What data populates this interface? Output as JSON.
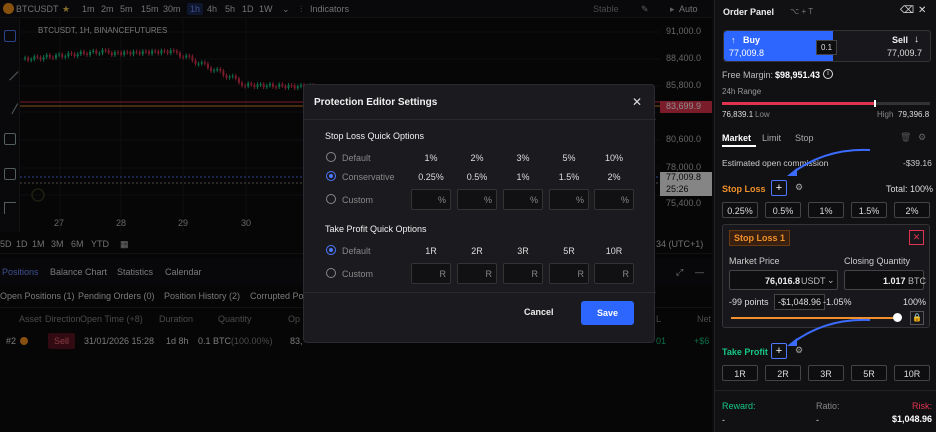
{
  "toolbar": {
    "symbol": "BTCUSDT",
    "intervals": [
      "1m",
      "2m",
      "5m",
      "15m",
      "30m",
      "1h",
      "4h",
      "5h",
      "1D",
      "1W"
    ],
    "indicators": "Indicators",
    "stable": "Stable",
    "auto": "Auto"
  },
  "chart": {
    "legend": "BTCUSDT, 1H, BINANCEFUTURES",
    "prices": [
      "91,000.0",
      "88,400.0",
      "85,800.0",
      "80,600.0",
      "78,000.0",
      "75,400.0"
    ],
    "tag_red": "83,699.9",
    "tag_white1": "77,009.8",
    "tag_white2": "25:26",
    "dates": [
      "27",
      "28",
      "29",
      "30"
    ]
  },
  "ranges": {
    "items": [
      "5D",
      "1D",
      "1M",
      "3M",
      "6M",
      "YTD"
    ],
    "tz": "34 (UTC+1)"
  },
  "tabs1": [
    "Positions",
    "Balance Chart",
    "Statistics",
    "Calendar"
  ],
  "tabs2": [
    "Open Positions (1)",
    "Pending Orders (0)",
    "Position History (2)",
    "Corrupted Po"
  ],
  "table": {
    "headers": [
      "Asset",
      "Direction",
      "Open Time (+8)",
      "Duration",
      "Quantity",
      "Op",
      "L",
      "Net"
    ],
    "row": {
      "num": "#2",
      "dir": "Sell",
      "time": "31/01/2026 15:28",
      "dur": "1d 8h",
      "qty": "0.1 BTC",
      "pct": "(100.00%)",
      "op": "83,",
      "pl": "01",
      "net": "+$6"
    }
  },
  "modal": {
    "title": "Protection Editor Settings",
    "sl_title": "Stop Loss Quick Options",
    "sl_rows": [
      {
        "label": "Default",
        "values": [
          "1%",
          "2%",
          "3%",
          "5%",
          "10%"
        ]
      },
      {
        "label": "Conservative",
        "values": [
          "0.25%",
          "0.5%",
          "1%",
          "1.5%",
          "2%"
        ]
      }
    ],
    "custom": "Custom",
    "pct": "%",
    "tp_title": "Take Profit Quick Options",
    "tp_rows": [
      {
        "label": "Default",
        "values": [
          "1R",
          "2R",
          "3R",
          "5R",
          "10R"
        ]
      }
    ],
    "r": "R",
    "cancel": "Cancel",
    "save": "Save"
  },
  "panel": {
    "title": "Order Panel",
    "shortcut": "⌥ + T",
    "buy": "Buy",
    "buy_price": "77,009.8",
    "qty": "0.1",
    "sell": "Sell",
    "sell_price": "77,009.7",
    "margin_label": "Free Margin:",
    "margin": "$98,951.43",
    "range_label": "24h Range",
    "low": "76,839.1",
    "low_lbl": "Low",
    "high_lbl": "High",
    "high": "79,396.8",
    "tabs": [
      "Market",
      "Limit",
      "Stop"
    ],
    "commission_label": "Estimated open commission",
    "commission": "-$39.16",
    "sl_label": "Stop Loss",
    "total": "Total: 100%",
    "sl_chips": [
      "0.25%",
      "0.5%",
      "1%",
      "1.5%",
      "2%"
    ],
    "sl_box_title": "Stop Loss 1",
    "mp_label": "Market Price",
    "cq_label": "Closing Quantity",
    "mp_value": "76,016.8",
    "mp_unit": "USDT",
    "cq_value": "1.017",
    "cq_unit": "BTC",
    "points": "-99 points",
    "amount": "-$1,048.96",
    "pct": "-1.05%",
    "hundred": "100%",
    "tp_label": "Take Profit",
    "tp_chips": [
      "1R",
      "2R",
      "3R",
      "5R",
      "10R"
    ],
    "reward": "Reward:",
    "ratio": "Ratio:",
    "risk": "Risk:",
    "dash1": "-",
    "dash2": "-",
    "risk_val": "$1,048.96"
  },
  "colors": {
    "accent": "#2d66ff",
    "red": "#e0334f",
    "green": "#16c784",
    "orange": "#f0902a"
  }
}
